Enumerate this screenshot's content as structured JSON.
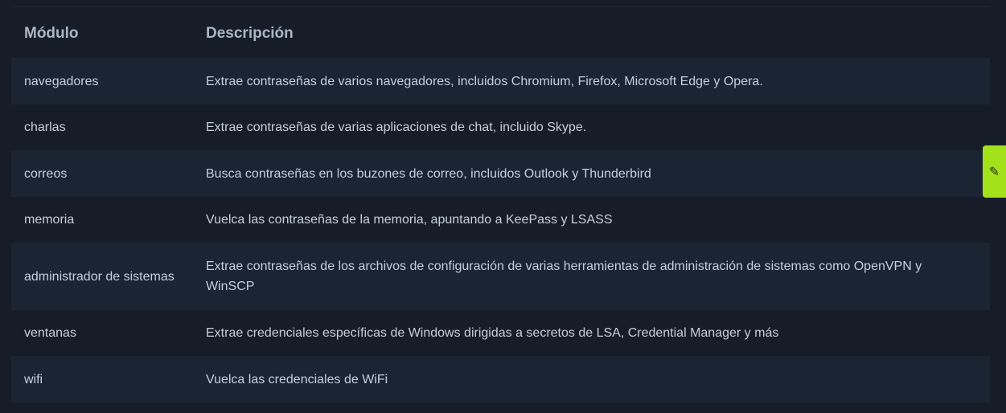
{
  "table": {
    "headers": {
      "module": "Módulo",
      "description": "Descripción"
    },
    "rows": [
      {
        "module": "navegadores",
        "description": "Extrae contraseñas de varios navegadores, incluidos Chromium, Firefox, Microsoft Edge y Opera."
      },
      {
        "module": "charlas",
        "description": "Extrae contraseñas de varias aplicaciones de chat, incluido Skype."
      },
      {
        "module": "correos",
        "description": "Busca contraseñas en los buzones de correo, incluidos Outlook y Thunderbird"
      },
      {
        "module": "memoria",
        "description": "Vuelca las contraseñas de la memoria, apuntando a KeePass y LSASS"
      },
      {
        "module": "administrador de sistemas",
        "description": "Extrae contraseñas de los archivos de configuración de varias herramientas de administración de sistemas como OpenVPN y WinSCP"
      },
      {
        "module": "ventanas",
        "description": "Extrae credenciales específicas de Windows dirigidas a secretos de LSA, Credential Manager y más"
      },
      {
        "module": "wifi",
        "description": "Vuelca las credenciales de WiFi"
      }
    ]
  },
  "edit_tab": {
    "icon": "pencil-icon",
    "glyph": "✎",
    "color": "#a3e11b"
  }
}
